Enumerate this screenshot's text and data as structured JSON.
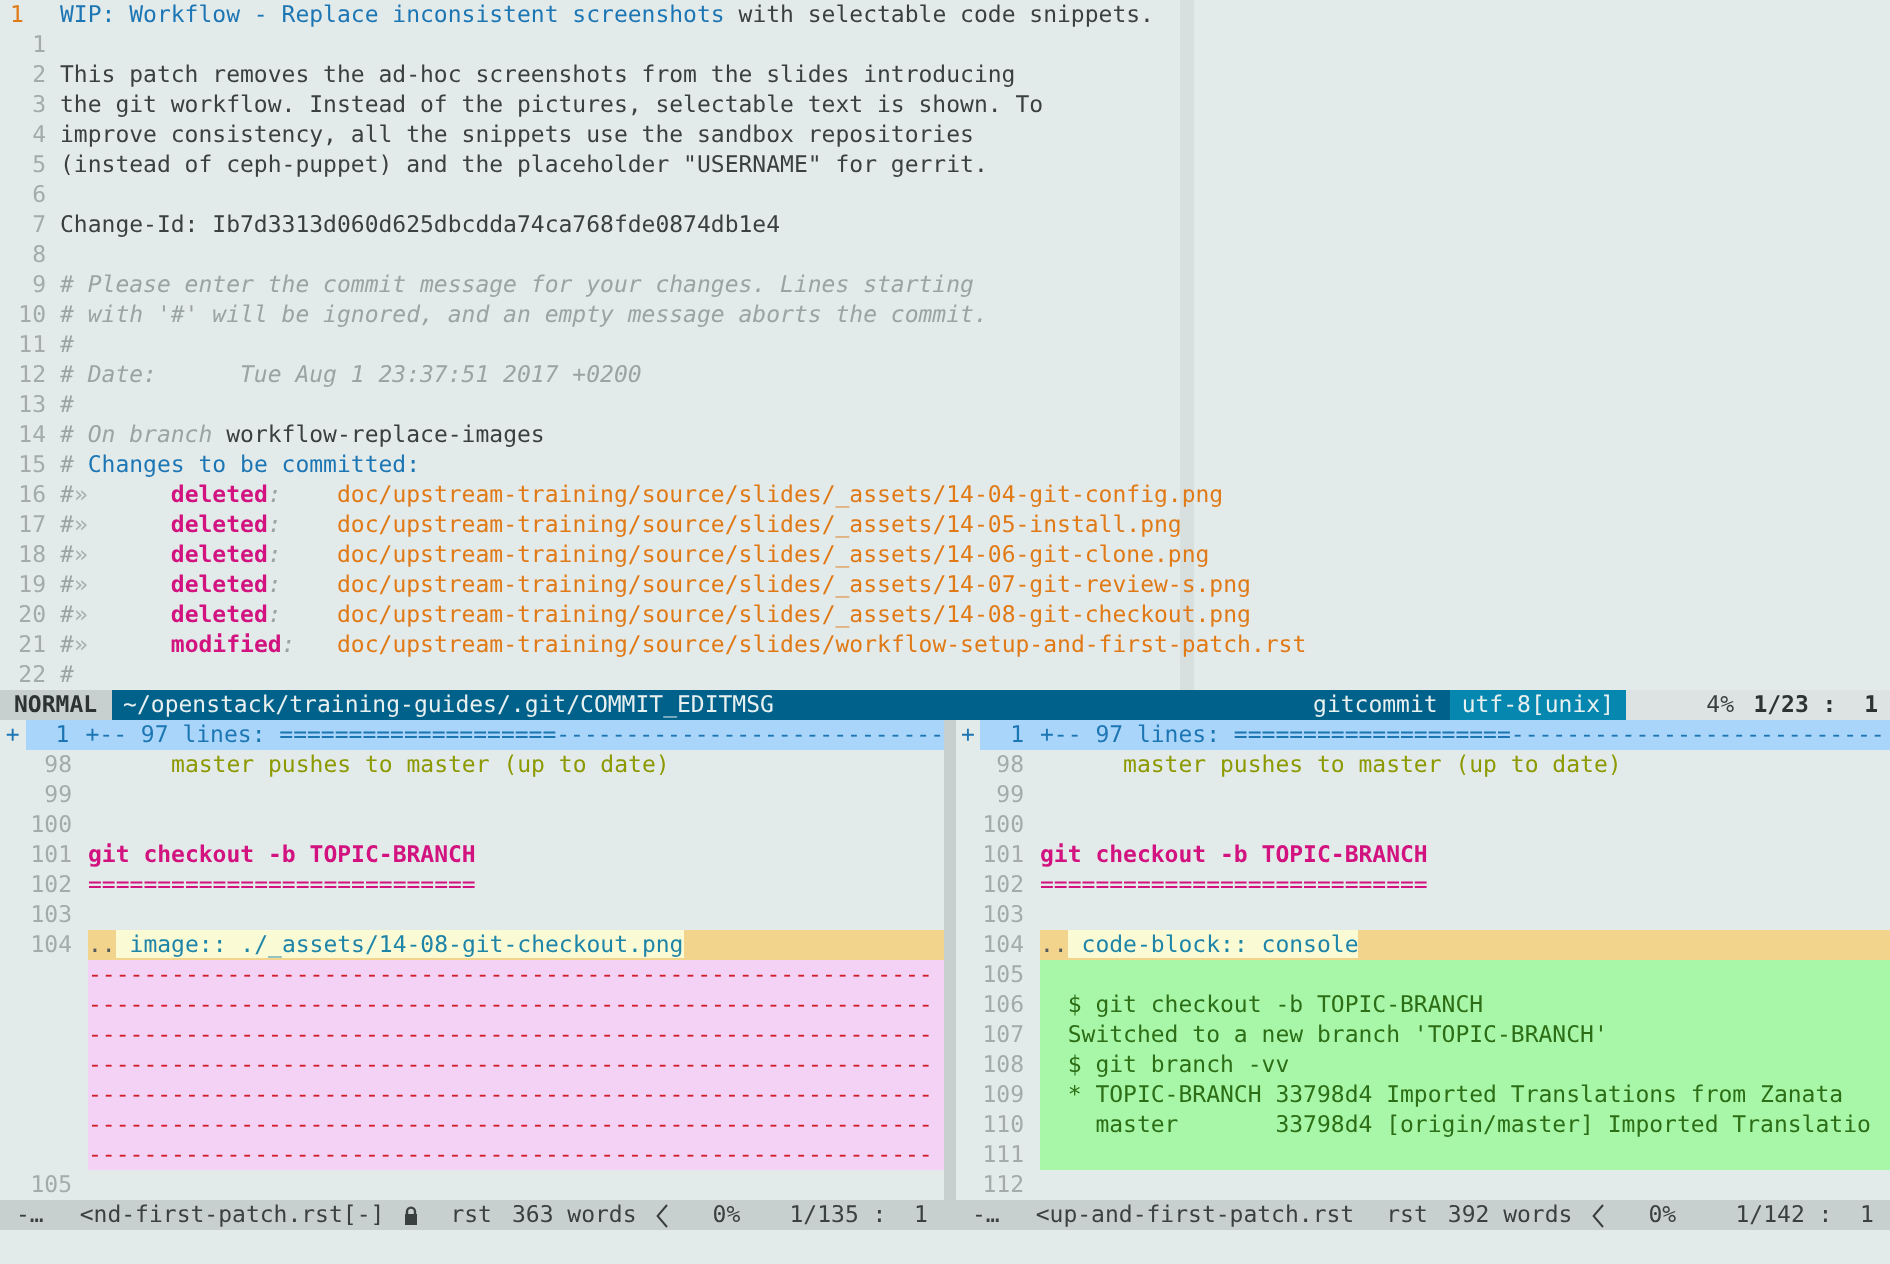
{
  "editor": {
    "lines": [
      {
        "number": "1",
        "current": true,
        "segments": [
          {
            "kind": "summary",
            "text": "WIP: Workflow - Replace inconsistent screenshots "
          },
          {
            "kind": "normal",
            "text": "with selectable code snippets."
          }
        ]
      },
      {
        "number": "1",
        "current": false
      },
      {
        "number": "2",
        "current": false,
        "segments": [
          {
            "kind": "normal",
            "text": "This patch removes the ad-hoc screenshots from the slides introducing"
          }
        ]
      },
      {
        "number": "3",
        "current": false,
        "segments": [
          {
            "kind": "normal",
            "text": "the git workflow. Instead of the pictures, selectable text is shown. To"
          }
        ]
      },
      {
        "number": "4",
        "current": false,
        "segments": [
          {
            "kind": "normal",
            "text": "improve consistency, all the snippets use the sandbox repositories"
          }
        ]
      },
      {
        "number": "5",
        "current": false,
        "segments": [
          {
            "kind": "normal",
            "text": "(instead of ceph-puppet) and the placeholder \"USERNAME\" for gerrit."
          }
        ]
      },
      {
        "number": "6",
        "current": false
      },
      {
        "number": "7",
        "current": false,
        "segments": [
          {
            "kind": "normal",
            "text": "Change-Id: Ib7d3313d060d625dbcdda74ca768fde0874db1e4"
          }
        ]
      },
      {
        "number": "8",
        "current": false
      },
      {
        "number": "9",
        "current": false,
        "segments": [
          {
            "kind": "comment",
            "text": "# Please enter the commit message for your changes. Lines starting"
          }
        ]
      },
      {
        "number": "10",
        "current": false,
        "segments": [
          {
            "kind": "comment",
            "text": "# with '#' will be ignored, and an empty message aborts the commit."
          }
        ]
      },
      {
        "number": "11",
        "current": false,
        "segments": [
          {
            "kind": "comment",
            "text": "#"
          }
        ]
      },
      {
        "number": "12",
        "current": false,
        "segments": [
          {
            "kind": "comment",
            "text": "# Date:      Tue Aug 1 23:37:51 2017 +0200"
          }
        ]
      },
      {
        "number": "13",
        "current": false,
        "segments": [
          {
            "kind": "comment",
            "text": "#"
          }
        ]
      },
      {
        "number": "14",
        "current": false,
        "segments": [
          {
            "kind": "comment",
            "text": "# On branch "
          },
          {
            "kind": "normal",
            "text": "workflow-replace-images"
          }
        ]
      },
      {
        "number": "15",
        "current": false,
        "segments": [
          {
            "kind": "comment",
            "text": "# "
          },
          {
            "kind": "header",
            "text": "Changes to be committed:"
          }
        ]
      },
      {
        "number": "16",
        "current": false,
        "segments": [
          {
            "kind": "comment",
            "text": "#"
          },
          {
            "kind": "tab",
            "text": "»      "
          },
          {
            "kind": "status",
            "text": "deleted"
          },
          {
            "kind": "comment",
            "text": ":    "
          },
          {
            "kind": "path",
            "text": "doc/upstream-training/source/slides/_assets/14-04-git-config.png"
          }
        ]
      },
      {
        "number": "17",
        "current": false,
        "segments": [
          {
            "kind": "comment",
            "text": "#"
          },
          {
            "kind": "tab",
            "text": "»      "
          },
          {
            "kind": "status",
            "text": "deleted"
          },
          {
            "kind": "comment",
            "text": ":    "
          },
          {
            "kind": "path",
            "text": "doc/upstream-training/source/slides/_assets/14-05-install.png"
          }
        ]
      },
      {
        "number": "18",
        "current": false,
        "segments": [
          {
            "kind": "comment",
            "text": "#"
          },
          {
            "kind": "tab",
            "text": "»      "
          },
          {
            "kind": "status",
            "text": "deleted"
          },
          {
            "kind": "comment",
            "text": ":    "
          },
          {
            "kind": "path",
            "text": "doc/upstream-training/source/slides/_assets/14-06-git-clone.png"
          }
        ]
      },
      {
        "number": "19",
        "current": false,
        "segments": [
          {
            "kind": "comment",
            "text": "#"
          },
          {
            "kind": "tab",
            "text": "»      "
          },
          {
            "kind": "status",
            "text": "deleted"
          },
          {
            "kind": "comment",
            "text": ":    "
          },
          {
            "kind": "path",
            "text": "doc/upstream-training/source/slides/_assets/14-07-git-review-s.png"
          }
        ]
      },
      {
        "number": "20",
        "current": false,
        "segments": [
          {
            "kind": "comment",
            "text": "#"
          },
          {
            "kind": "tab",
            "text": "»      "
          },
          {
            "kind": "status",
            "text": "deleted"
          },
          {
            "kind": "comment",
            "text": ":    "
          },
          {
            "kind": "path",
            "text": "doc/upstream-training/source/slides/_assets/14-08-git-checkout.png"
          }
        ]
      },
      {
        "number": "21",
        "current": false,
        "segments": [
          {
            "kind": "comment",
            "text": "#"
          },
          {
            "kind": "tab",
            "text": "»      "
          },
          {
            "kind": "status",
            "text": "modified"
          },
          {
            "kind": "comment",
            "text": ":   "
          },
          {
            "kind": "path",
            "text": "doc/upstream-training/source/slides/workflow-setup-and-first-patch.rst"
          }
        ]
      },
      {
        "number": "22",
        "current": false,
        "segments": [
          {
            "kind": "comment",
            "text": "#"
          }
        ]
      }
    ]
  },
  "status_bar": {
    "mode": "NORMAL",
    "path": "~/openstack/training-guides/.git/COMMIT_EDITMSG",
    "filetype": "gitcommit",
    "encoding": "utf-8[unix]",
    "percent": "4%",
    "position": "1/23 :  1"
  },
  "diff_panes": [
    {
      "rows": [
        {
          "kind": "fold",
          "sign": "+",
          "number": "1",
          "text": "+-- 97 lines: ====================----------------------------"
        },
        {
          "kind": "normal",
          "number": "98",
          "segments": [
            {
              "kind": "olive",
              "text": "      master pushes to master (up to date)"
            }
          ]
        },
        {
          "kind": "normal",
          "number": "99"
        },
        {
          "kind": "normal",
          "number": "100"
        },
        {
          "kind": "normal",
          "number": "101",
          "segments": [
            {
              "kind": "heading",
              "text": "git checkout -b TOPIC-BRANCH"
            }
          ]
        },
        {
          "kind": "normal",
          "number": "102",
          "segments": [
            {
              "kind": "heading_rule",
              "text": "============================"
            }
          ]
        },
        {
          "kind": "normal",
          "number": "103"
        },
        {
          "kind": "changed",
          "number": "104",
          "segments": [
            {
              "kind": "dots",
              "text": ".."
            },
            {
              "kind": "directive",
              "changed": true,
              "text": " image:: ./_assets/14-08-git-checkout.png"
            }
          ]
        },
        {
          "kind": "filler",
          "text": "-------------------------------------------------------------"
        },
        {
          "kind": "filler",
          "text": "-------------------------------------------------------------"
        },
        {
          "kind": "filler",
          "text": "-------------------------------------------------------------"
        },
        {
          "kind": "filler",
          "text": "-------------------------------------------------------------"
        },
        {
          "kind": "filler",
          "text": "-------------------------------------------------------------"
        },
        {
          "kind": "filler",
          "text": "-------------------------------------------------------------"
        },
        {
          "kind": "filler",
          "text": "-------------------------------------------------------------"
        },
        {
          "kind": "normal",
          "number": "105"
        }
      ],
      "status": {
        "mode": "-…",
        "file": "<nd-first-patch.rst[-]",
        "readonly": true,
        "filetype": "rst",
        "words": "363 words",
        "percent": "0%",
        "position": "1/135 :  1"
      }
    },
    {
      "rows": [
        {
          "kind": "fold",
          "sign": "+",
          "number": "1",
          "text": "+-- 97 lines: ====================---------------------------"
        },
        {
          "kind": "normal",
          "number": "98",
          "segments": [
            {
              "kind": "olive",
              "text": "      master pushes to master (up to date)"
            }
          ]
        },
        {
          "kind": "normal",
          "number": "99"
        },
        {
          "kind": "normal",
          "number": "100"
        },
        {
          "kind": "normal",
          "number": "101",
          "segments": [
            {
              "kind": "heading",
              "text": "git checkout -b TOPIC-BRANCH"
            }
          ]
        },
        {
          "kind": "normal",
          "number": "102",
          "segments": [
            {
              "kind": "heading_rule",
              "text": "============================"
            }
          ]
        },
        {
          "kind": "normal",
          "number": "103"
        },
        {
          "kind": "changed",
          "number": "104",
          "segments": [
            {
              "kind": "dots",
              "text": ".."
            },
            {
              "kind": "directive",
              "changed": true,
              "text": " code-block:: console"
            }
          ]
        },
        {
          "kind": "added",
          "number": "105"
        },
        {
          "kind": "added",
          "number": "106",
          "segments": [
            {
              "kind": "console",
              "text": "  $ git checkout -b TOPIC-BRANCH"
            }
          ]
        },
        {
          "kind": "added",
          "number": "107",
          "segments": [
            {
              "kind": "console",
              "text": "  Switched to a new branch 'TOPIC-BRANCH'"
            }
          ]
        },
        {
          "kind": "added",
          "number": "108",
          "segments": [
            {
              "kind": "console",
              "text": "  $ git branch -vv"
            }
          ]
        },
        {
          "kind": "added",
          "number": "109",
          "segments": [
            {
              "kind": "console",
              "text": "  * TOPIC-BRANCH 33798d4 Imported Translations from Zanata"
            }
          ]
        },
        {
          "kind": "added",
          "number": "110",
          "segments": [
            {
              "kind": "console",
              "text": "    master       33798d4 [origin/master] Imported Translatio"
            }
          ]
        },
        {
          "kind": "added",
          "number": "111"
        },
        {
          "kind": "normal",
          "number": "112"
        }
      ],
      "status": {
        "mode": "-…",
        "file": "<up-and-first-patch.rst",
        "readonly": false,
        "filetype": "rst",
        "words": "392 words",
        "percent": "0%",
        "position": "1/142 :  1"
      }
    }
  ]
}
